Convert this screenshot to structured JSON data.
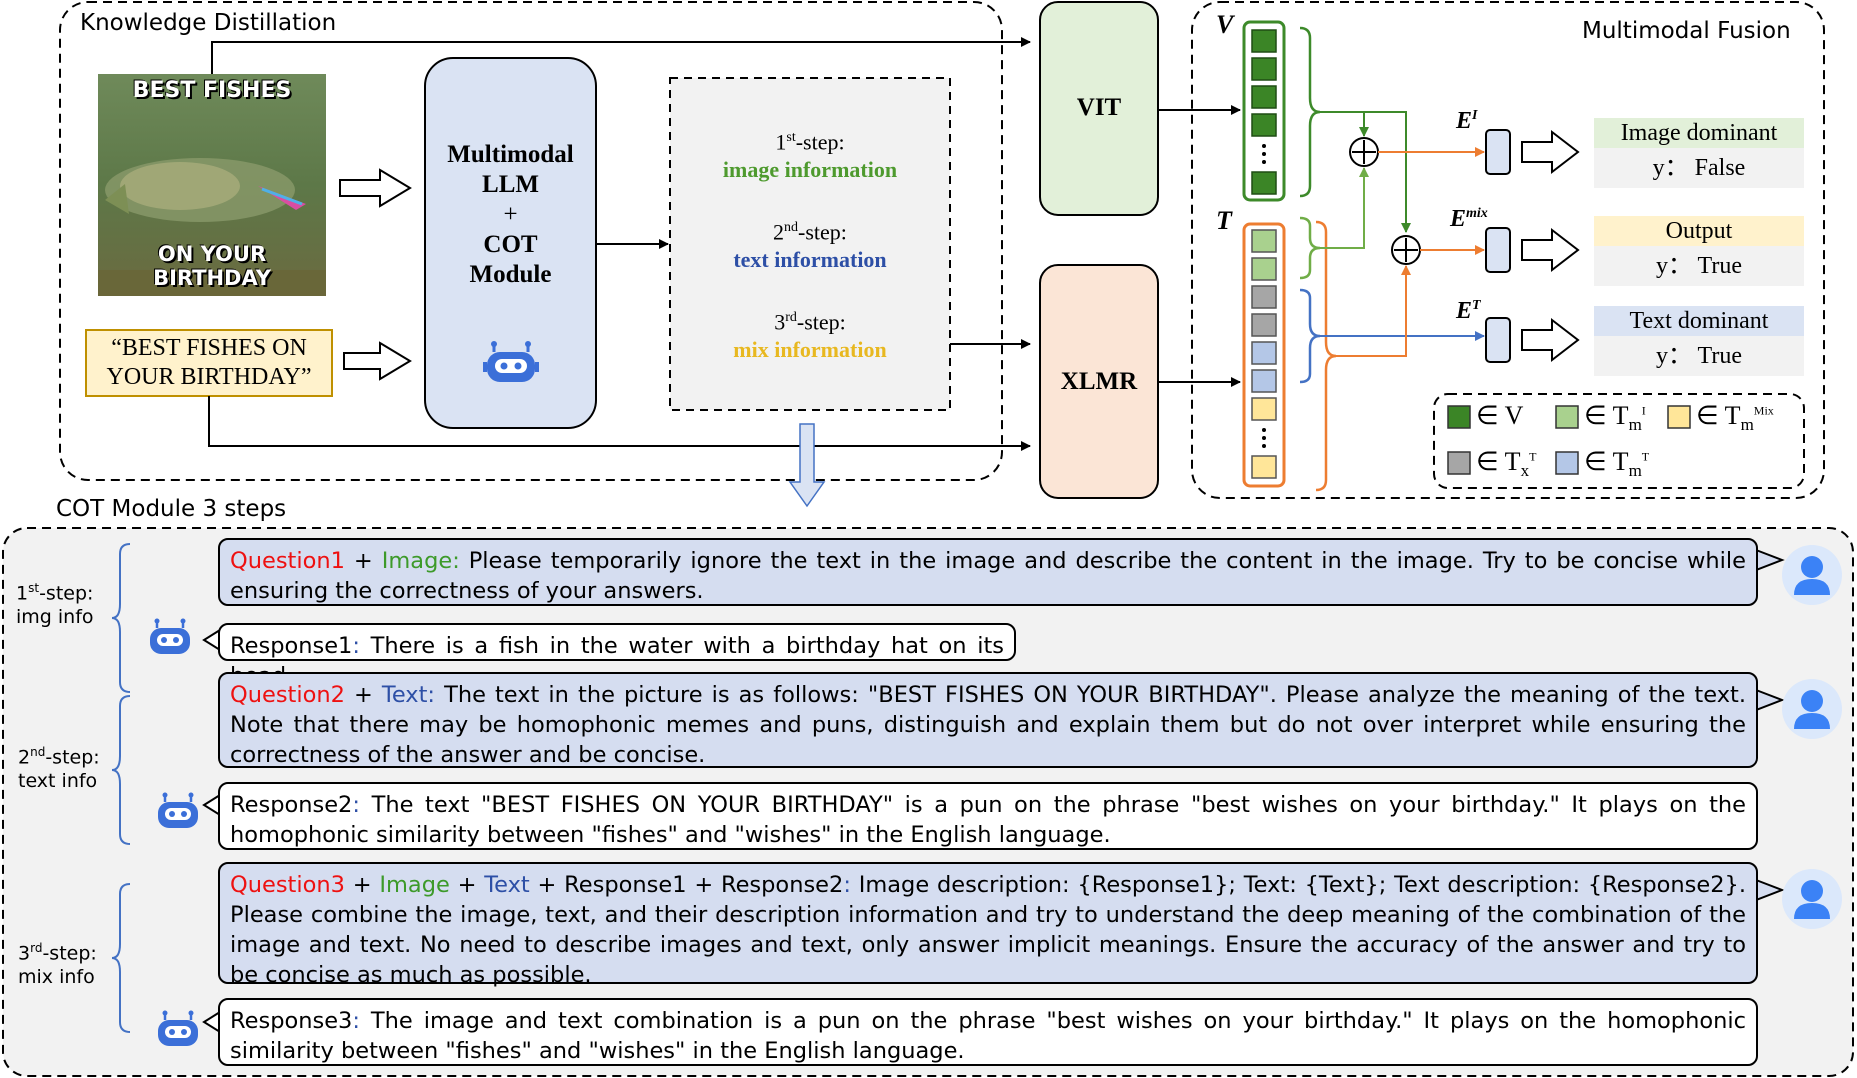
{
  "headers": {
    "knowledge_distillation": "Knowledge Distillation",
    "multimodal_fusion": "Multimodal Fusion",
    "cot_module_steps": "COT Module 3 steps"
  },
  "meme": {
    "top_text": "BEST FISHES",
    "bottom_text": "ON YOUR BIRTHDAY",
    "quote_line1": "“BEST FISHES ON",
    "quote_line2": "YOUR BIRTHDAY”"
  },
  "llm_box": {
    "line1": "Multimodal",
    "line2": "LLM",
    "line3": "+",
    "line4": "COT",
    "line5": "Module"
  },
  "steps_box": [
    {
      "ordinal": "1",
      "suffix": "st",
      "label": "-step:",
      "info": "image information",
      "color": "#4e9a2e"
    },
    {
      "ordinal": "2",
      "suffix": "nd",
      "label": "-step:",
      "info": "text information",
      "color": "#2d4fa6"
    },
    {
      "ordinal": "3",
      "suffix": "rd",
      "label": "-step:",
      "info": "mix information",
      "color": "#e8b820"
    }
  ],
  "encoders": {
    "vit": "VIT",
    "xlmr": "XLMR",
    "vit_color": "#e2f0d9",
    "xlmr_color": "#fbe5d6"
  },
  "fusion": {
    "v_label": "V",
    "t_label": "T",
    "e_image": "E",
    "e_image_sup": "I",
    "e_mix": "E",
    "e_mix_sup": "mix",
    "e_text": "E",
    "e_text_sup": "T",
    "outputs": [
      {
        "title": "Image dominant",
        "value": "y： False",
        "title_bg": "#e2f0d9"
      },
      {
        "title": "Output",
        "value": "y：  True",
        "title_bg": "#fff2cc"
      },
      {
        "title": "Text dominant",
        "value": "y：  True",
        "title_bg": "#dae3f3"
      }
    ],
    "legend": [
      {
        "symbol": "∈ V",
        "color": "#3b8526"
      },
      {
        "symbol": "∈ T",
        "sub": "m",
        "subsup": "I",
        "color": "#a9d18e"
      },
      {
        "symbol": "∈ T",
        "sub": "m",
        "subsup": "Mix",
        "color": "#ffe699"
      },
      {
        "symbol": "∈ T",
        "sub": "x",
        "subsup": "T",
        "color": "#a6a6a6"
      },
      {
        "symbol": "∈ T",
        "sub": "m",
        "subsup": "T",
        "color": "#b4c7e7"
      }
    ]
  },
  "cot": {
    "steps": [
      {
        "ordinal": "1",
        "suffix": "st",
        "label": "-step:",
        "sub": "img info"
      },
      {
        "ordinal": "2",
        "suffix": "nd",
        "label": "-step:",
        "sub": "text info"
      },
      {
        "ordinal": "3",
        "suffix": "rd",
        "label": "-step:",
        "sub": "mix info"
      }
    ],
    "q1": {
      "tag": "Question1",
      "plus1": " + ",
      "img": "Image:",
      "body": " Please temporarily ignore the text in the image and describe the content in the image. Try to be concise while ensuring the correctness of your answers."
    },
    "r1": {
      "tag": "Response1",
      "colon": ":",
      "body": " There is a fish in the water with a birthday hat on its head."
    },
    "q2": {
      "tag": "Question2",
      "plus1": " + ",
      "txt": "Text:",
      "body": " The text in the picture is as follows: \"BEST FISHES ON YOUR BIRTHDAY\". Please analyze the meaning of the text. Note that there may be homophonic memes and puns, distinguish and explain them but do not over interpret while ensuring the correctness of the answer and be concise."
    },
    "r2": {
      "tag": "Response2",
      "colon": ":",
      "body": " The text \"BEST FISHES ON YOUR BIRTHDAY\" is a pun on the phrase \"best wishes on your birthday.\" It plays on the homophonic similarity between \"fishes\" and \"wishes\" in the English language."
    },
    "q3": {
      "tag": "Question3",
      "plus1": " + ",
      "img": "Image",
      "plus2": " + ",
      "txt": "Text",
      "plus3": " + ",
      "resp1": "Response1",
      "plus4": " + ",
      "resp2": "Response2",
      "colon": ":",
      "body": " Image description: {Response1}; Text: {Text}; Text description: {Response2}. Please combine the image, text, and their description information and try to understand the deep meaning of the combination of the image and text. No need to describe images and text, only answer implicit meanings. Ensure the accuracy of the answer and try to be concise as much as possible."
    },
    "r3": {
      "tag": "Response3",
      "colon": ":",
      "body": " The image and text combination is a pun on the phrase \"best wishes on your birthday.\" It plays on the homophonic similarity between \"fishes\" and \"wishes\" in the English language."
    }
  }
}
